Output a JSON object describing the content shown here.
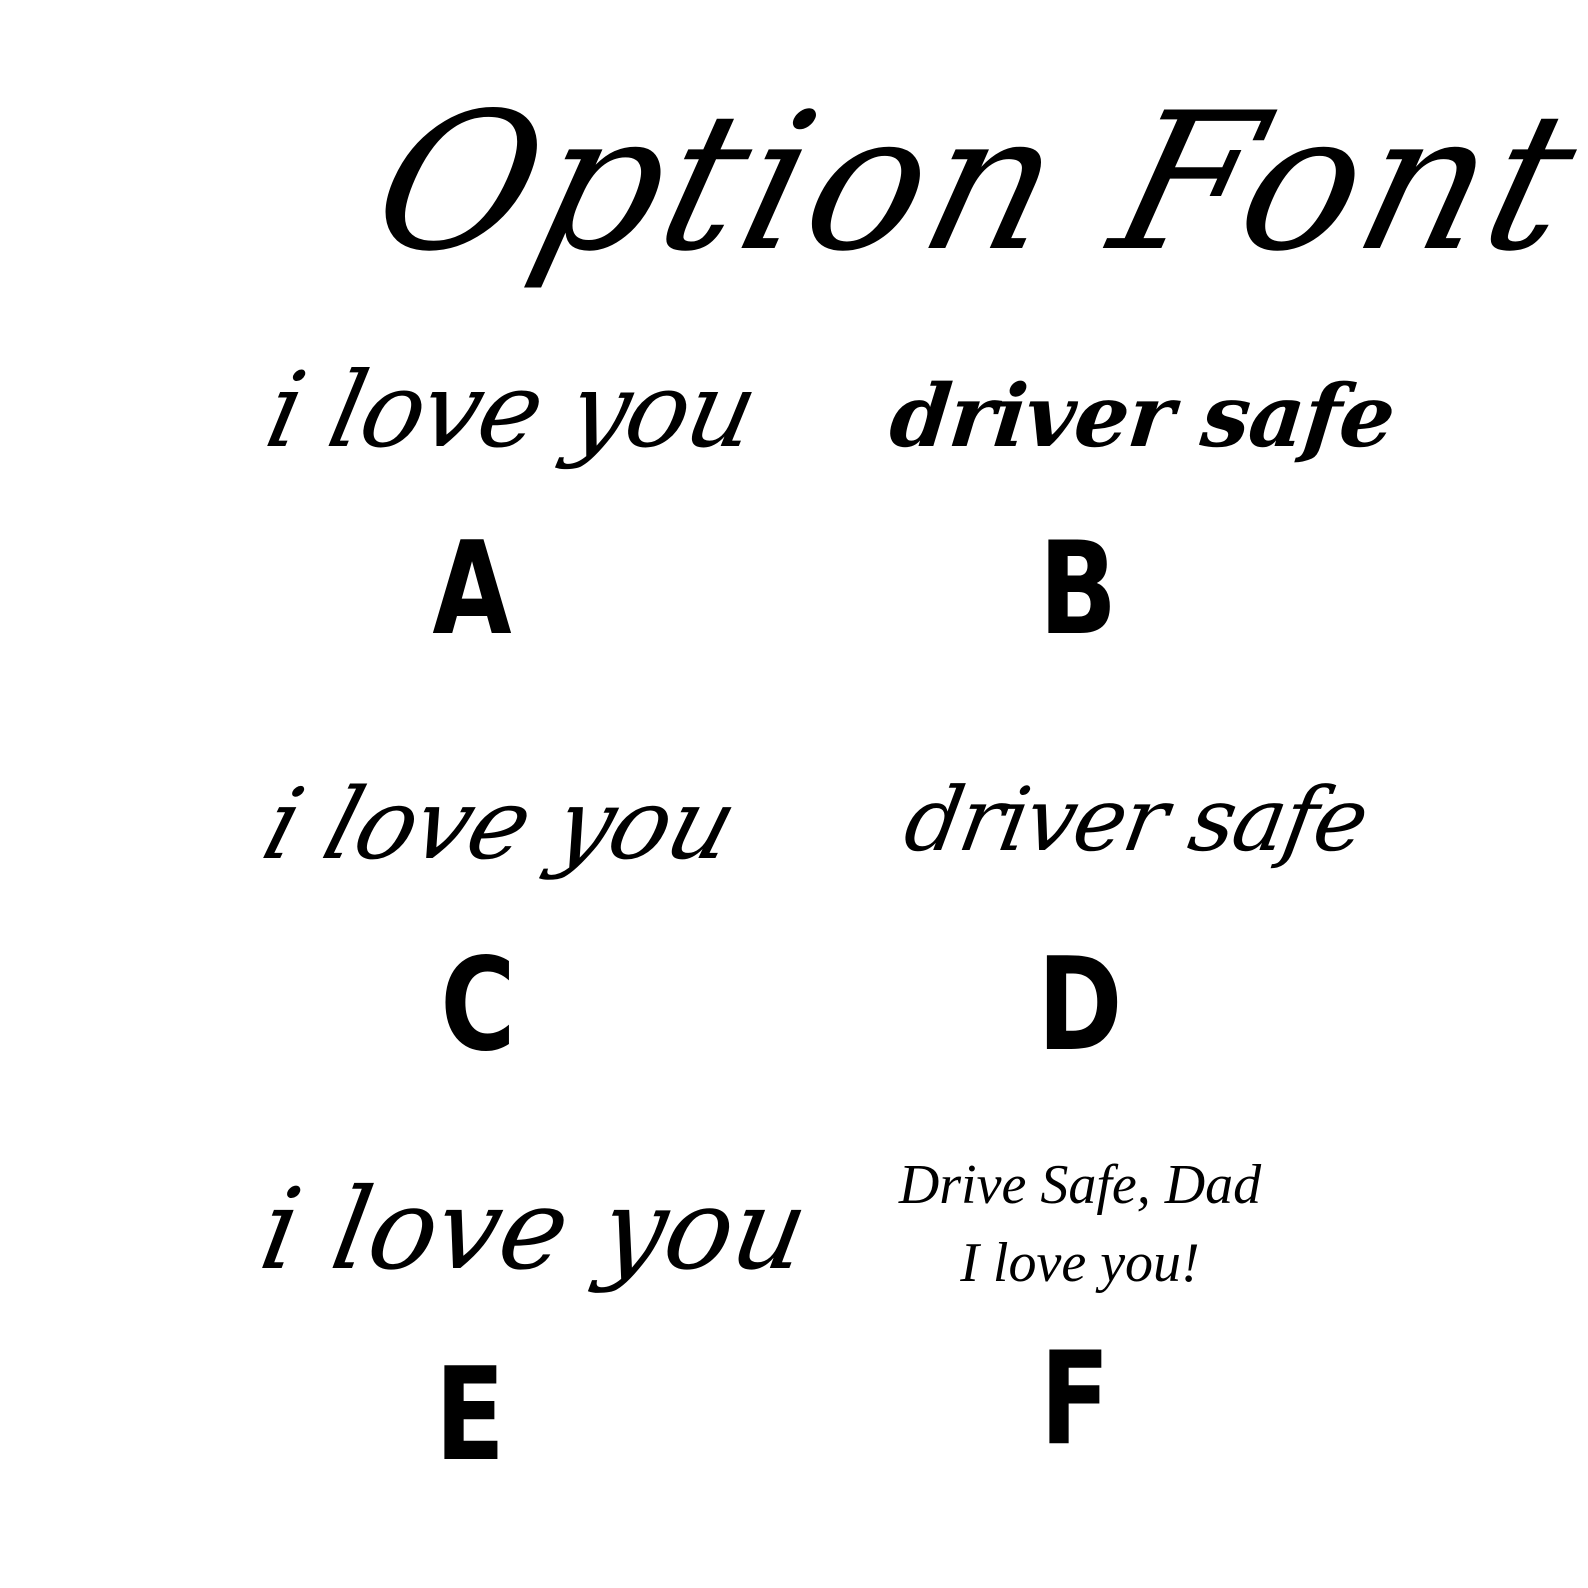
{
  "title": "Option Font",
  "options": [
    {
      "label": "A",
      "sample": "i love you"
    },
    {
      "label": "B",
      "sample": "driver safe"
    },
    {
      "label": "C",
      "sample": "i love you"
    },
    {
      "label": "D",
      "sample": "driver safe"
    },
    {
      "label": "E",
      "sample": "i love you"
    },
    {
      "label": "F",
      "sample_lines": [
        "Drive Safe, Dad",
        "I love you!"
      ]
    }
  ]
}
